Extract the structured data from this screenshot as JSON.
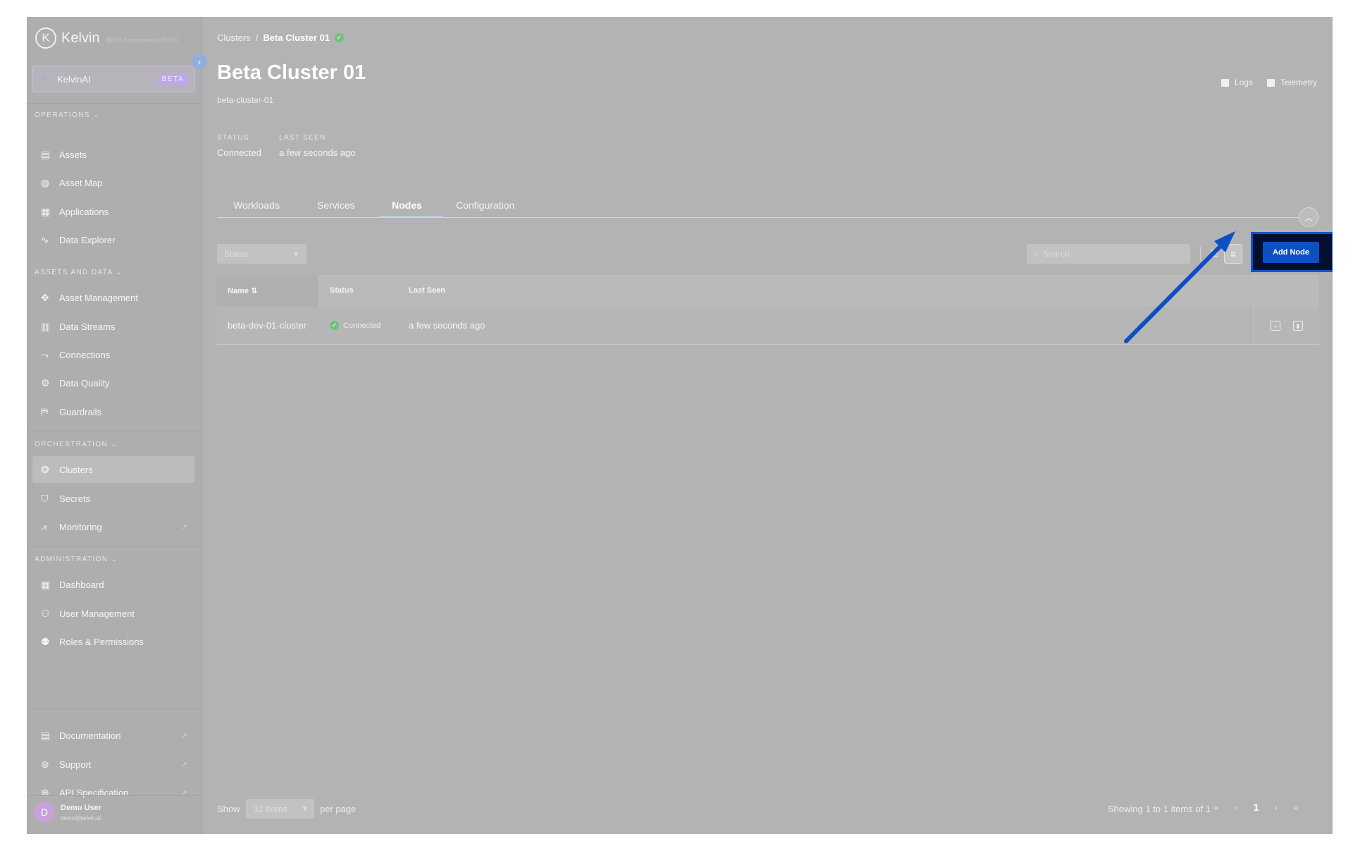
{
  "brand": {
    "name": "Kelvin",
    "env": "BETA Environment (DEV)",
    "logo_letter": "K"
  },
  "kelvin_ai": {
    "label": "KelvinAI",
    "badge": "BETA"
  },
  "sidebar": {
    "sections": [
      {
        "label": "OPERATIONS",
        "items": [
          {
            "label": "Assets",
            "icon": "assets-icon"
          },
          {
            "label": "Asset Map",
            "icon": "globe-icon"
          },
          {
            "label": "Applications",
            "icon": "apps-icon"
          },
          {
            "label": "Data Explorer",
            "icon": "pulse-icon"
          }
        ]
      },
      {
        "label": "ASSETS AND DATA",
        "items": [
          {
            "label": "Asset Management",
            "icon": "asset-management-icon"
          },
          {
            "label": "Data Streams",
            "icon": "bar-chart-icon"
          },
          {
            "label": "Connections",
            "icon": "connections-icon"
          },
          {
            "label": "Data Quality",
            "icon": "gear-icon"
          },
          {
            "label": "Guardrails",
            "icon": "barrier-icon"
          }
        ]
      },
      {
        "label": "ORCHESTRATION",
        "items": [
          {
            "label": "Clusters",
            "icon": "cluster-icon",
            "active": true
          },
          {
            "label": "Secrets",
            "icon": "shield-icon"
          },
          {
            "label": "Monitoring",
            "icon": "monitoring-icon",
            "external": true
          }
        ]
      },
      {
        "label": "ADMINISTRATION",
        "items": [
          {
            "label": "Dashboard",
            "icon": "dashboard-icon"
          },
          {
            "label": "User Management",
            "icon": "users-icon"
          },
          {
            "label": "Roles & Permissions",
            "icon": "roles-icon"
          }
        ]
      }
    ],
    "bottom_items": [
      {
        "label": "Documentation",
        "icon": "document-icon",
        "external": true
      },
      {
        "label": "Support",
        "icon": "lifebuoy-icon",
        "external": true
      },
      {
        "label": "API Specification",
        "icon": "api-icon",
        "external": true
      }
    ],
    "user": {
      "initial": "D",
      "name": "Demo User",
      "email": "demo@kelvin.ai"
    }
  },
  "breadcrumb": {
    "parent": "Clusters",
    "separator": "/",
    "current": "Beta Cluster 01"
  },
  "page": {
    "title": "Beta Cluster 01",
    "subtitle": "beta-cluster-01"
  },
  "header_actions": {
    "logs": "Logs",
    "telemetry": "Telemetry"
  },
  "meta": {
    "status_label": "STATUS",
    "status_value": "Connected",
    "last_seen_label": "LAST SEEN",
    "last_seen_value": "a few seconds ago"
  },
  "tabs": [
    "Workloads",
    "Services",
    "Nodes",
    "Configuration"
  ],
  "active_tab": "Nodes",
  "toolbar": {
    "status_placeholder": "Status",
    "search_placeholder": "Search",
    "add_button": "Add Node"
  },
  "table": {
    "columns": [
      "Name",
      "Status",
      "Last Seen"
    ],
    "rows": [
      {
        "name": "beta-dev-01-cluster",
        "status": "Connected",
        "last_seen": "a few seconds ago"
      }
    ]
  },
  "footer": {
    "show_label": "Show",
    "per_page_value": "32 items",
    "per_page_suffix": "per page",
    "showing": "Showing 1 to 1 items of 1",
    "current_page": "1"
  },
  "colors": {
    "highlight": "#0f56c8",
    "overlay": "#b3b3b3",
    "success": "#6fc07e",
    "arrow": "#0d4fc5"
  }
}
